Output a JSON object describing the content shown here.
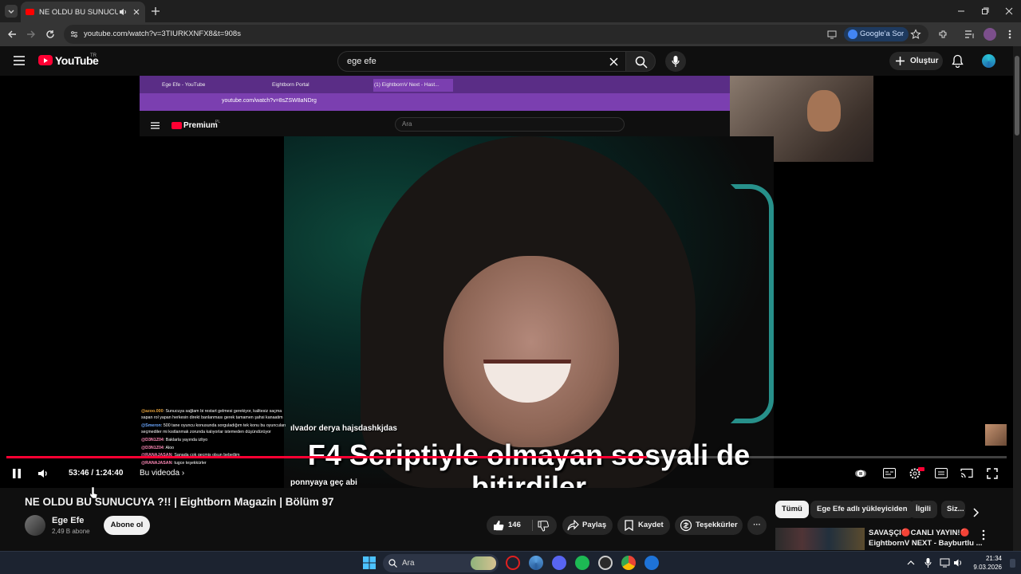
{
  "browser": {
    "tab_title": "NE OLDU BU SUNUCUYA ?!! | Eightborn Magazin | Bölüm 97",
    "url": "youtube.com/watch?v=3TIURKXNFX8&t=908s",
    "google_lens_label": "Google'a Sor"
  },
  "masthead": {
    "logo_text": "YouTube",
    "country_code": "TR",
    "search_query": "ege efe",
    "create_label": "Oluştur"
  },
  "player": {
    "inner_browser": {
      "tabs": [
        "Ege Efe - YouTube",
        "Eightborn Portal",
        "(1) EightbornV Next - Hast..."
      ],
      "url": "youtube.com/watch?v=8sZSW8aNDrg",
      "premium_label": "Premium",
      "premium_country": "PL",
      "search_placeholder": "Ara"
    },
    "subtitle_line1": "F4 Scriptiyle olmayan sosyali de",
    "subtitle_line2": "bitirdiler",
    "overlay_line1": "ılvador derya hajsdashkjdas",
    "overlay_line2": "ponnyaya geç abi",
    "chat": [
      {
        "user": "@azoo.000",
        "text": ": Sunucuya sağlam bi restart gelmesi gerekiyor, kalitesiz saçma sapan rol yapan herkesin direkt banlanması gerek tamamen şahsi kanaatim",
        "color": "orange"
      },
      {
        "user": "@Smeron",
        "text": ": 500 tane oyuncu konusunda sorguladığım tek konu bu oyuncuları seçmediler mi kıstlanmak zorunda kalıyorlar istemeden düşündürüyor",
        "color": "blue"
      },
      {
        "user": "@D3N1Z04",
        "text": ": Baklarla yayında izliyo",
        "color": "pink"
      },
      {
        "user": "@D3N1Z04",
        "text": ": Aloo",
        "color": "pink"
      },
      {
        "user": "@RANAJASAN",
        "text": ": Sanada çok geçmiş olsun bebeğim",
        "color": "pink"
      },
      {
        "user": "@RANAJASAN",
        "text": ": tugce teşekkürler",
        "color": "pink"
      }
    ],
    "progress": 0.6403,
    "current_time": "53:46",
    "duration": "1:24:40",
    "chapter_label": "Bu videoda",
    "chapter_chevron": "›"
  },
  "video": {
    "title": "NE OLDU BU SUNUCUYA ?!! | Eightborn Magazin | Bölüm 97",
    "channel_name": "Ege Efe",
    "subscriber_count": "2,49 B abone",
    "subscribe_label": "Abone ol",
    "like_count": "146",
    "share_label": "Paylaş",
    "save_label": "Kaydet",
    "thanks_label": "Teşekkürler",
    "more_label": "···"
  },
  "sidebar": {
    "chips": [
      "Tümü",
      "Ege Efe adlı yükleyiciden",
      "İlgili",
      "Siz..."
    ],
    "recommendation": {
      "title": "SAVAŞÇI🔴CANLI YAYIN!🔴",
      "channel": "EightbornV NEXT - Bayburtlu ..."
    }
  },
  "taskbar": {
    "search_placeholder": "Ara",
    "time": "21:34",
    "date": "9.03.2026"
  },
  "colors": {
    "accent_red": "#ff0033",
    "background": "#0f0f0f",
    "inner_browser_purple": "#7b3fb0"
  }
}
